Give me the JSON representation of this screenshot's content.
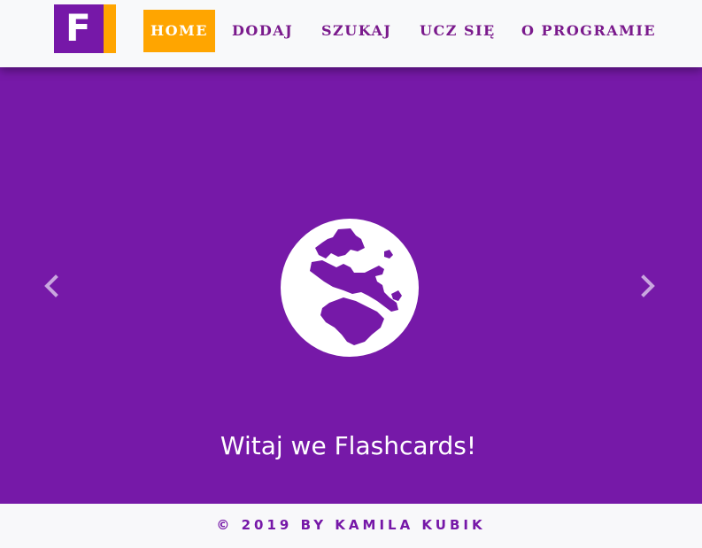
{
  "brand": {
    "logo_letter": "F",
    "primary_color": "#7619a8",
    "accent_color": "#ffa500"
  },
  "nav": {
    "items": [
      {
        "label": "HOME",
        "active": true
      },
      {
        "label": "DODAJ",
        "active": false
      },
      {
        "label": "SZUKAJ",
        "active": false
      },
      {
        "label": "UCZ SIĘ",
        "active": false
      },
      {
        "label": "O PROGRAMIE",
        "active": false
      }
    ]
  },
  "carousel": {
    "icon": "globe-icon",
    "caption": "Witaj we Flashcards!",
    "prev_icon": "chevron-left-icon",
    "next_icon": "chevron-right-icon"
  },
  "footer": {
    "text": "© 2019 BY KAMILA KUBIK"
  }
}
